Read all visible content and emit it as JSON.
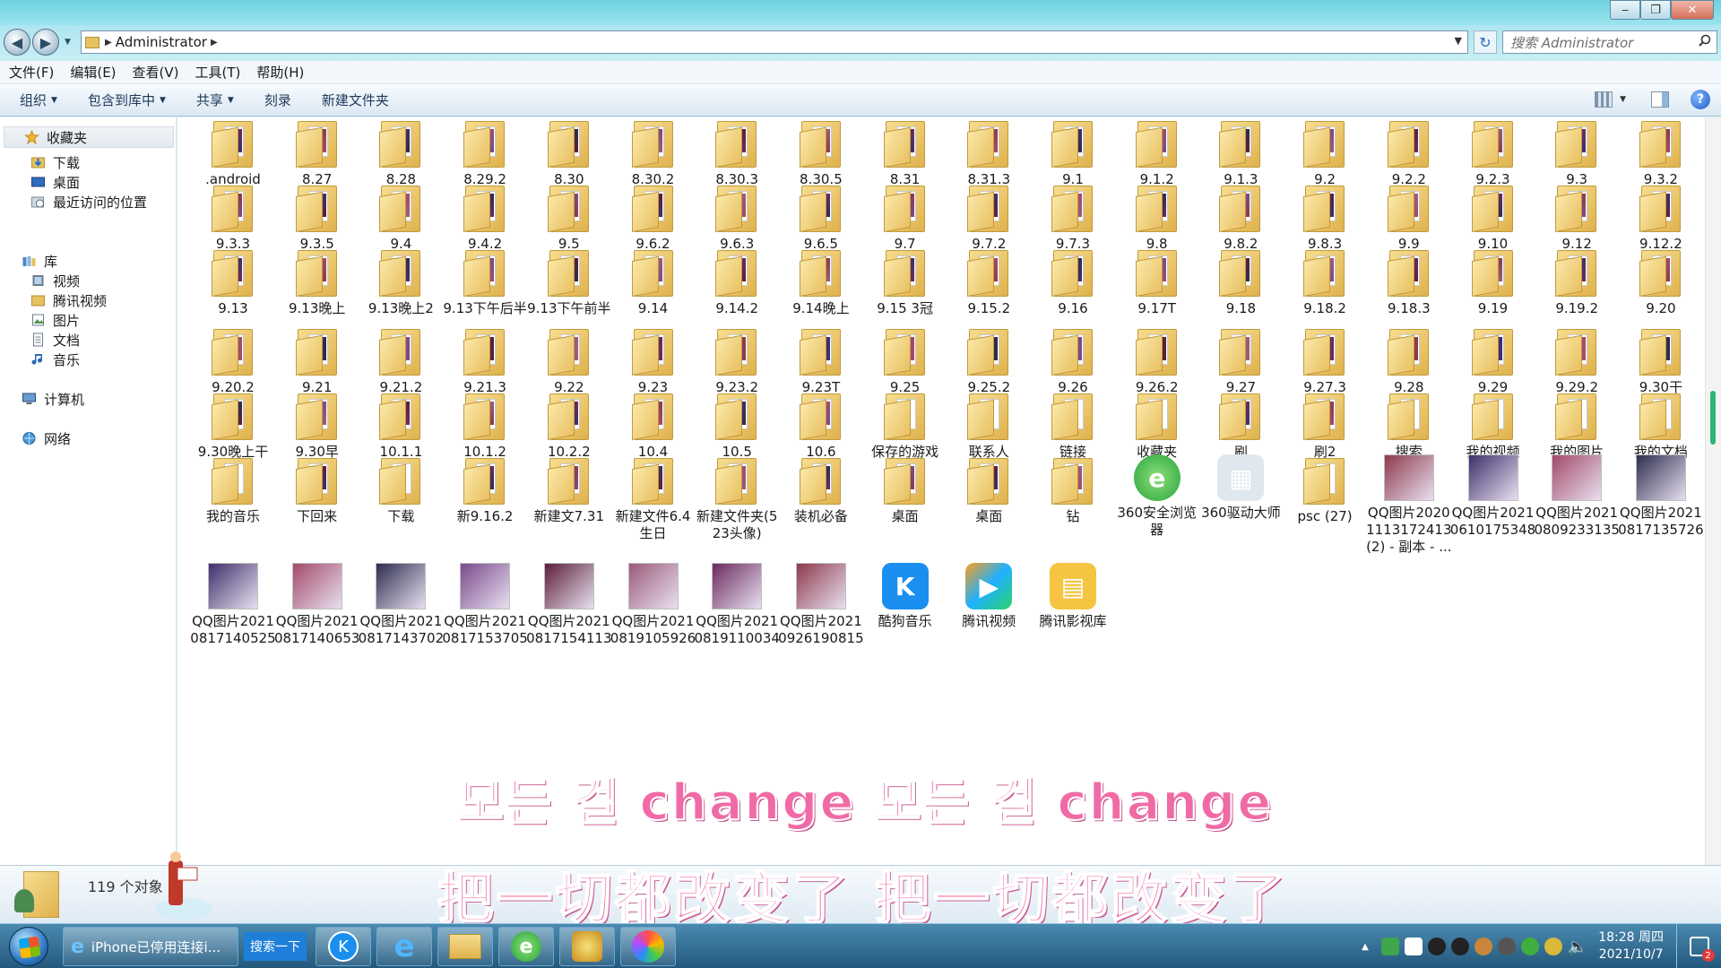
{
  "window": {
    "address_segment": "Administrator",
    "search_placeholder": "搜索 Administrator"
  },
  "menu": [
    "文件(F)",
    "编辑(E)",
    "查看(V)",
    "工具(T)",
    "帮助(H)"
  ],
  "toolbar": {
    "organize": "组织",
    "include_in_library": "包含到库中",
    "share": "共享",
    "burn": "刻录",
    "new_folder": "新建文件夹"
  },
  "nav": {
    "favorites": "收藏夹",
    "downloads": "下载",
    "desktop": "桌面",
    "recent": "最近访问的位置",
    "libraries": "库",
    "videos": "视频",
    "tencent_video": "腾讯视频",
    "pictures": "图片",
    "documents": "文档",
    "music": "音乐",
    "computer": "计算机",
    "network": "网络"
  },
  "items": [
    [
      ".android",
      "8.27",
      "8.28",
      "8.29.2",
      "8.30",
      "8.30.2",
      "8.30.3",
      "8.30.5",
      "8.31",
      "8.31.3",
      "9.1",
      "9.1.2",
      "9.1.3",
      "9.2",
      "9.2.2",
      "9.2.3",
      "9.3",
      "9.3.2"
    ],
    [
      "9.3.3",
      "9.3.5",
      "9.4",
      "9.4.2",
      "9.5",
      "9.6.2",
      "9.6.3",
      "9.6.5",
      "9.7",
      "9.7.2",
      "9.7.3",
      "9.8",
      "9.8.2",
      "9.8.3",
      "9.9",
      "9.10",
      "9.12",
      "9.12.2"
    ],
    [
      "9.13",
      "9.13晚上",
      "9.13晚上2",
      "9.13下午后半",
      "9.13下午前半",
      "9.14",
      "9.14.2",
      "9.14晚上",
      "9.15 3冠",
      "9.15.2",
      "9.16",
      "9.17T",
      "9.18",
      "9.18.2",
      "9.18.3",
      "9.19",
      "9.19.2",
      "9.20"
    ],
    [
      "9.20.2",
      "9.21",
      "9.21.2",
      "9.21.3",
      "9.22",
      "9.23",
      "9.23.2",
      "9.23T",
      "9.25",
      "9.25.2",
      "9.26",
      "9.26.2",
      "9.27",
      "9.27.3",
      "9.28",
      "9.29",
      "9.29.2",
      "9.30干"
    ],
    [
      "9.30晚上干",
      "9.30早",
      "10.1.1",
      "10.1.2",
      "10.2.2",
      "10.4",
      "10.5",
      "10.6",
      "保存的游戏",
      "联系人",
      "链接",
      "收藏夹",
      "刷",
      "刷2",
      "搜索",
      "我的视频",
      "我的图片",
      "我的文档"
    ],
    [
      "我的音乐",
      "下回来",
      "下载",
      "新9.16.2",
      "新建文7.31",
      "新建文件6.4生日",
      "新建文件夹(523头像)",
      "装机必备",
      "桌面",
      "桌面",
      "钻",
      "360安全浏览器",
      "360驱动大师",
      "psc (27)",
      "QQ图片20201113172413 (2) - 副本 - ...",
      "QQ图片20210610175348",
      "QQ图片20210809233135",
      "QQ图片20210817135726"
    ],
    [
      "QQ图片20210817140525",
      "QQ图片20210817140653",
      "QQ图片20210817143702",
      "QQ图片20210817153705",
      "QQ图片20210817154113",
      "QQ图片20210819105926",
      "QQ图片20210819110034",
      "QQ图片20210926190815",
      "酷狗音乐",
      "腾讯视频",
      "腾讯影视库"
    ]
  ],
  "status": {
    "count": "119 个对象"
  },
  "taskbar": {
    "ie_window": "iPhone已停用连接i...",
    "search_once": "搜索一下",
    "time": "18:28 周四",
    "date": "2021/10/7"
  },
  "subtitles": {
    "korean": "모든 걸 change  모든 걸 change",
    "chinese": "把一切都改变了  把一切都改变了"
  },
  "colors": {
    "subtitle": "#f06ba6",
    "folder": "#e8c062",
    "taskbar": "#2f6d95"
  }
}
